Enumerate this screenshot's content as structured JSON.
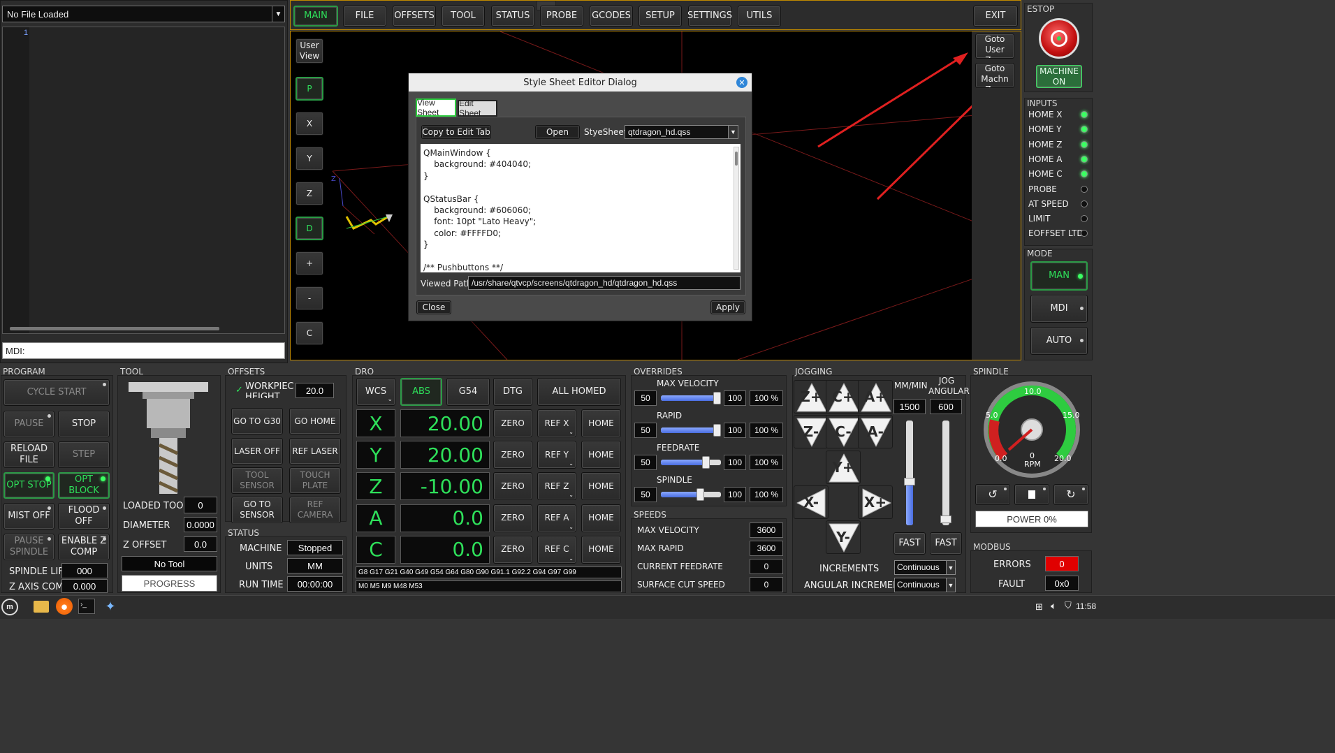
{
  "file_combo": {
    "value": "No File Loaded"
  },
  "editor": {
    "line1": "1"
  },
  "mdi": {
    "label": "MDI:"
  },
  "tabs": [
    "MAIN",
    "FILE",
    "OFFSETS",
    "TOOL",
    "STATUS",
    "PROBE",
    "GCODES",
    "SETUP",
    "SETTINGS",
    "UTILS"
  ],
  "exit_label": "EXIT",
  "estop": {
    "title": "ESTOP",
    "machine_label": "MACHINE ON"
  },
  "view_buttons": [
    "User View",
    "P",
    "X",
    "Y",
    "Z",
    "D",
    "+",
    "-",
    "C"
  ],
  "goto_buttons": [
    "Goto User Zero",
    "Goto Machn Zero"
  ],
  "inputs": {
    "title": "INPUTS",
    "items": [
      {
        "label": "HOME X",
        "on": true
      },
      {
        "label": "HOME Y",
        "on": true
      },
      {
        "label": "HOME Z",
        "on": true
      },
      {
        "label": "HOME A",
        "on": true
      },
      {
        "label": "HOME C",
        "on": true
      },
      {
        "label": "PROBE",
        "on": false
      },
      {
        "label": "AT SPEED",
        "on": false
      },
      {
        "label": "LIMIT",
        "on": false
      },
      {
        "label": "EOFFSET LTD",
        "on": false
      }
    ]
  },
  "mode": {
    "title": "MODE",
    "items": [
      "MAN",
      "MDI",
      "AUTO"
    ]
  },
  "dialog": {
    "title": "Style Sheet Editor Dialog",
    "tab_view": "View Sheet",
    "tab_edit": "Edit Sheet",
    "copy_btn": "Copy to Edit Tab",
    "open_btn": "Open",
    "stylesheet_label": "StyeSheet:",
    "stylesheet_value": "qtdragon_hd.qss",
    "code_lines": [
      "QMainWindow {",
      "    background: #404040;",
      "}",
      "",
      "QStatusBar {",
      "    background: #606060;",
      "    font: 10pt \"Lato Heavy\";",
      "    color: #FFFFD0;",
      "}",
      "",
      "/** Pushbuttons **/"
    ],
    "viewed_path_label": "Viewed Path:",
    "viewed_path": "/usr/share/qtvcp/screens/qtdragon_hd/qtdragon_hd.qss",
    "close_btn": "Close",
    "apply_btn": "Apply"
  },
  "program": {
    "title": "PROGRAM",
    "buttons": [
      "CYCLE START",
      "PAUSE",
      "STOP",
      "RELOAD FILE",
      "STEP",
      "OPT STOP",
      "OPT BLOCK",
      "MIST OFF",
      "FLOOD OFF",
      "PAUSE SPINDLE",
      "ENABLE Z COMP"
    ],
    "spindle_lift_label": "SPINDLE LIFT",
    "spindle_lift": "000",
    "zaxis_comp_label": "Z AXIS COMP",
    "zaxis_comp": "0.000"
  },
  "tool": {
    "title": "TOOL",
    "loaded_label": "LOADED TOOL",
    "loaded": "0",
    "diameter_label": "DIAMETER",
    "diameter": "0.0000",
    "zoffset_label": "Z OFFSET",
    "zoffset": "0.0",
    "tool_name": "No Tool",
    "progress": "PROGRESS"
  },
  "offsets": {
    "title": "OFFSETS",
    "workpiece_label": "WORKPIECE HEIGHT",
    "workpiece": "20.0",
    "buttons": [
      "GO TO G30",
      "GO HOME",
      "LASER OFF",
      "REF LASER",
      "TOOL SENSOR",
      "TOUCH PLATE",
      "GO TO SENSOR",
      "REF CAMERA"
    ]
  },
  "status": {
    "title": "STATUS",
    "machine_label": "MACHINE",
    "machine": "Stopped",
    "units_label": "UNITS",
    "units": "MM",
    "runtime_label": "RUN TIME",
    "runtime": "00:00:00"
  },
  "dro": {
    "title": "DRO",
    "header": [
      "WCS",
      "ABS",
      "G54",
      "DTG",
      "ALL HOMED"
    ],
    "axes": [
      {
        "axis": "X",
        "value": "20.00",
        "ref": "REF X"
      },
      {
        "axis": "Y",
        "value": "20.00",
        "ref": "REF Y"
      },
      {
        "axis": "Z",
        "value": "-10.00",
        "ref": "REF Z"
      },
      {
        "axis": "A",
        "value": "0.0",
        "ref": "REF A"
      },
      {
        "axis": "C",
        "value": "0.0",
        "ref": "REF C"
      }
    ],
    "zero_label": "ZERO",
    "home_label": "HOME",
    "gcodes": "G8 G17 G21 G40 G49 G54 G64 G80 G90 G91.1 G92.2 G94 G97 G99",
    "mcodes": "M0 M5 M9 M48 M53"
  },
  "overrides": {
    "title": "OVERRIDES",
    "items": [
      {
        "label": "MAX VELOCITY",
        "min": "50",
        "max": "100",
        "pct": "100 %",
        "level": 1.0
      },
      {
        "label": "RAPID",
        "min": "50",
        "max": "100",
        "pct": "100 %",
        "level": 1.0
      },
      {
        "label": "FEEDRATE",
        "min": "50",
        "max": "100",
        "pct": "100 %",
        "level": 0.78
      },
      {
        "label": "SPINDLE",
        "min": "50",
        "max": "100",
        "pct": "100 %",
        "level": 0.68
      }
    ]
  },
  "speeds": {
    "title": "SPEEDS",
    "items": [
      {
        "label": "MAX VELOCITY",
        "value": "3600"
      },
      {
        "label": "MAX RAPID",
        "value": "3600"
      },
      {
        "label": "CURRENT FEEDRATE",
        "value": "0"
      },
      {
        "label": "SURFACE CUT SPEED",
        "value": "0"
      }
    ]
  },
  "jogging": {
    "title": "JOGGING",
    "buttons": [
      "Z+",
      "C+",
      "A+",
      "Z-",
      "C-",
      "A-",
      "Y+",
      "X-",
      "X+",
      "Y-"
    ],
    "mm_label": "MM/MIN",
    "jog_label": "JOG ANGULAR",
    "mm_value": "1500",
    "ang_value": "600",
    "fast": "FAST",
    "increments_label": "INCREMENTS",
    "increments": "Continuous",
    "ang_inc_label": "ANGULAR INCREMENT",
    "ang_inc": "Continuous"
  },
  "spindle": {
    "title": "SPINDLE",
    "gauge_labels": [
      "10.0",
      "5.0",
      "15.0",
      "0.0",
      "20.0",
      "0",
      "RPM"
    ],
    "power": "POWER 0%"
  },
  "modbus": {
    "title": "MODBUS",
    "errors_label": "ERRORS",
    "errors": "0",
    "fault_label": "FAULT",
    "fault": "0x0"
  },
  "taskbar": {
    "clock": "11:58"
  }
}
